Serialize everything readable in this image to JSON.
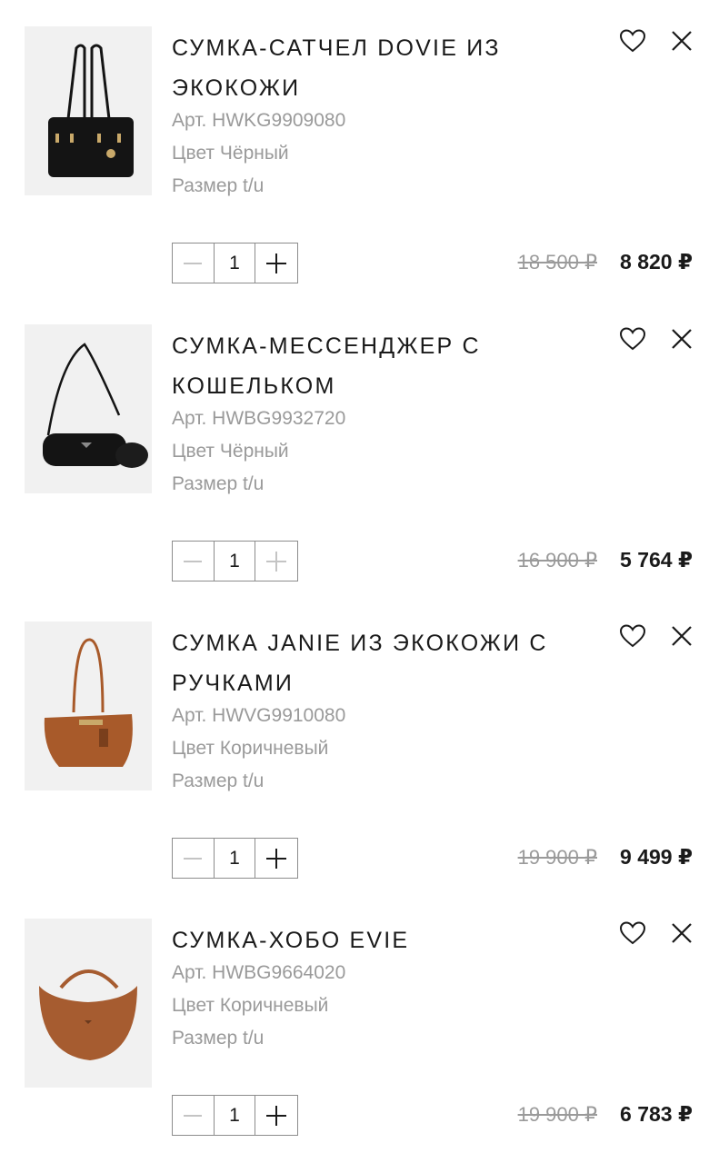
{
  "items": [
    {
      "title": "СУМКА-САТЧЕЛ DOVIE ИЗ ЭКОКОЖИ",
      "sku": "Арт. HWKG9909080",
      "color": "Цвет Чёрный",
      "size": "Размер t/u",
      "quantity": "1",
      "old_price": "18 500 ₽",
      "price": "8 820 ₽",
      "plus_enabled": true,
      "bag_color": "#141414"
    },
    {
      "title": "СУМКА-МЕССЕНДЖЕР С КОШЕЛЬКОМ",
      "sku": "Арт. HWBG9932720",
      "color": "Цвет Чёрный",
      "size": "Размер t/u",
      "quantity": "1",
      "old_price": "16 900 ₽",
      "price": "5 764 ₽",
      "plus_enabled": false,
      "bag_color": "#141414"
    },
    {
      "title": "СУМКА JANIE ИЗ ЭКОКОЖИ С РУЧКАМИ",
      "sku": "Арт. HWVG9910080",
      "color": "Цвет Коричневый",
      "size": "Размер t/u",
      "quantity": "1",
      "old_price": "19 900 ₽",
      "price": "9 499 ₽",
      "plus_enabled": true,
      "bag_color": "#a85a2a"
    },
    {
      "title": "СУМКА-ХОБО EVIE",
      "sku": "Арт. HWBG9664020",
      "color": "Цвет Коричневый",
      "size": "Размер t/u",
      "quantity": "1",
      "old_price": "19 900 ₽",
      "price": "6 783 ₽",
      "plus_enabled": true,
      "bag_color": "#a65c30"
    }
  ]
}
